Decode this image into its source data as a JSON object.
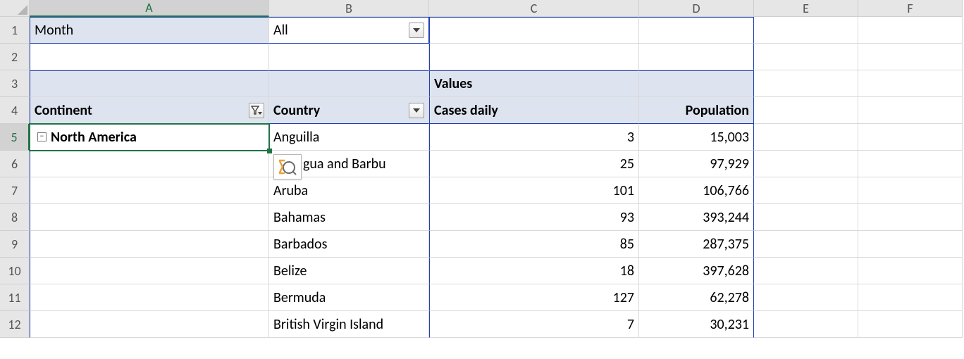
{
  "columns": [
    "A",
    "B",
    "C",
    "D",
    "E",
    "F"
  ],
  "row_numbers": [
    "1",
    "2",
    "3",
    "4",
    "5",
    "6",
    "7",
    "8",
    "9",
    "10",
    "11",
    "12"
  ],
  "pivot": {
    "filter_field": "Month",
    "filter_value": "All",
    "values_label": "Values",
    "row_fields": {
      "continent": "Continent",
      "country": "Country"
    },
    "data_fields": {
      "cases": "Cases daily",
      "population": "Population"
    },
    "continent_value": "North America",
    "rows": [
      {
        "country": "Anguilla",
        "cases": "3",
        "population": "15,003"
      },
      {
        "country": "gua and Barbu",
        "cases": "25",
        "population": "97,929"
      },
      {
        "country": "Aruba",
        "cases": "101",
        "population": "106,766"
      },
      {
        "country": "Bahamas",
        "cases": "93",
        "population": "393,244"
      },
      {
        "country": "Barbados",
        "cases": "85",
        "population": "287,375"
      },
      {
        "country": "Belize",
        "cases": "18",
        "population": "397,628"
      },
      {
        "country": "Bermuda",
        "cases": "127",
        "population": "62,278"
      },
      {
        "country": "British Virgin Island",
        "cases": "7",
        "population": "30,231"
      }
    ]
  }
}
